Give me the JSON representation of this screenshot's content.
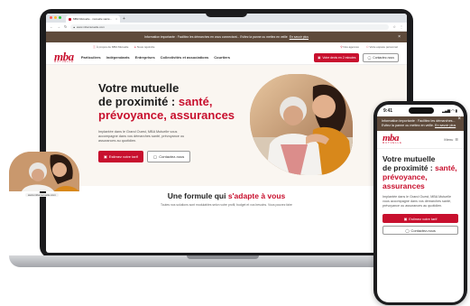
{
  "browser": {
    "tab_title": "MBA Mutuelle - mutuelle santé...",
    "tab_close": "×",
    "new_tab": "+",
    "url": "www.mbamutuelle.com",
    "traffic_colors": [
      "#ff5f57",
      "#febc2e",
      "#28c840"
    ]
  },
  "site": {
    "banner_text": "Information importante : Facilitez les démarches en vous connectant... Evitez la panne ou mettez en veille",
    "banner_link": "En savoir plus",
    "banner_close": "×",
    "meta_left": [
      "À propos de MBA Mutuelle",
      "Nous rejoindre"
    ],
    "meta_right": [
      "Nos agences",
      "Votre espace personnel"
    ],
    "logo_mark": "mba",
    "logo_sub": "MUTUELLE",
    "menu": [
      "Particuliers",
      "Indépendants",
      "Entreprises",
      "Collectivités et associations",
      "Courtiers"
    ],
    "nav_cta": "Votre devis en 2 minutes",
    "nav_contact": "Contactez-nous",
    "hero": {
      "title_line1": "Votre mutuelle",
      "title_line2_black": "de proximité : ",
      "title_line2_red": "santé,",
      "title_line3_red": "prévoyance, assurances",
      "paragraph": "Implantée dans le Grand Ouest, MBA Mutuelle vous accompagne dans vos démarches santé, prévoyance ou assurances au quotidien.",
      "btn_primary": "Estimez votre tarif",
      "btn_secondary": "Contactez-nous"
    },
    "section": {
      "title_black": "Une formule qui ",
      "title_red": "s'adapte à vous",
      "subtitle": "Toutes nos solutions sont modulables selon votre profil, budget et vos besoins. Vous pouvez faire"
    }
  },
  "phone": {
    "time": "9:41",
    "signal": "▂▄▆ ◠ ▮",
    "banner_text": "Information importante : Facilitez les démarches... Evitez la panne ou mettez en veille.",
    "banner_link": "En savoir plus",
    "banner_close": "×",
    "logo_mark": "mba",
    "logo_sub": "MUTUELLE",
    "menu_label": "Menu",
    "title_line1": "Votre mutuelle",
    "title_line2_black": "de proximité : ",
    "title_line2_red": "santé,",
    "title_line3_red": "prévoyance, assurances",
    "paragraph": "Implantée dans le Grand Ouest, MBA Mutuelle vous accompagne dans vos démarches santé, prévoyance ou assurances au quotidien.",
    "btn_primary": "Estimez votre tarif",
    "btn_secondary": "Contactez-nous",
    "url": "www.mbamutuelle.com"
  },
  "colors": {
    "brand_red": "#c8102e",
    "banner_brown": "#5e4a3b",
    "hero_bg": "#faf6f1"
  }
}
